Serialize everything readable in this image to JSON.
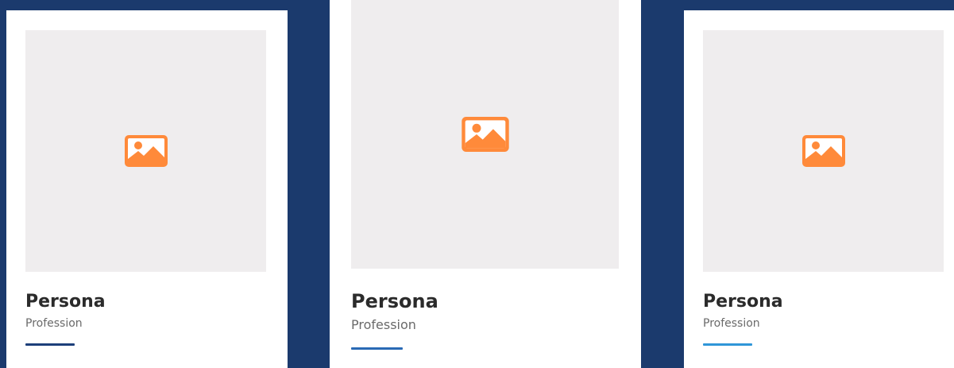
{
  "colors": {
    "dark_panel": "#1b3a6d",
    "photo_placeholder": "#efedee",
    "icon_orange": "#ff8a3a",
    "name_text": "#2b2b2b",
    "profession_text": "#6a6a6a"
  },
  "cards": [
    {
      "icon": "image-placeholder-icon",
      "name": "Persona",
      "profession": "Profession",
      "accent_color": "#1d3f7a"
    },
    {
      "icon": "image-placeholder-icon",
      "name": "Persona",
      "profession": "Profession",
      "accent_color": "#2a6ab5"
    },
    {
      "icon": "image-placeholder-icon",
      "name": "Persona",
      "profession": "Profession",
      "accent_color": "#2f96d8"
    }
  ]
}
